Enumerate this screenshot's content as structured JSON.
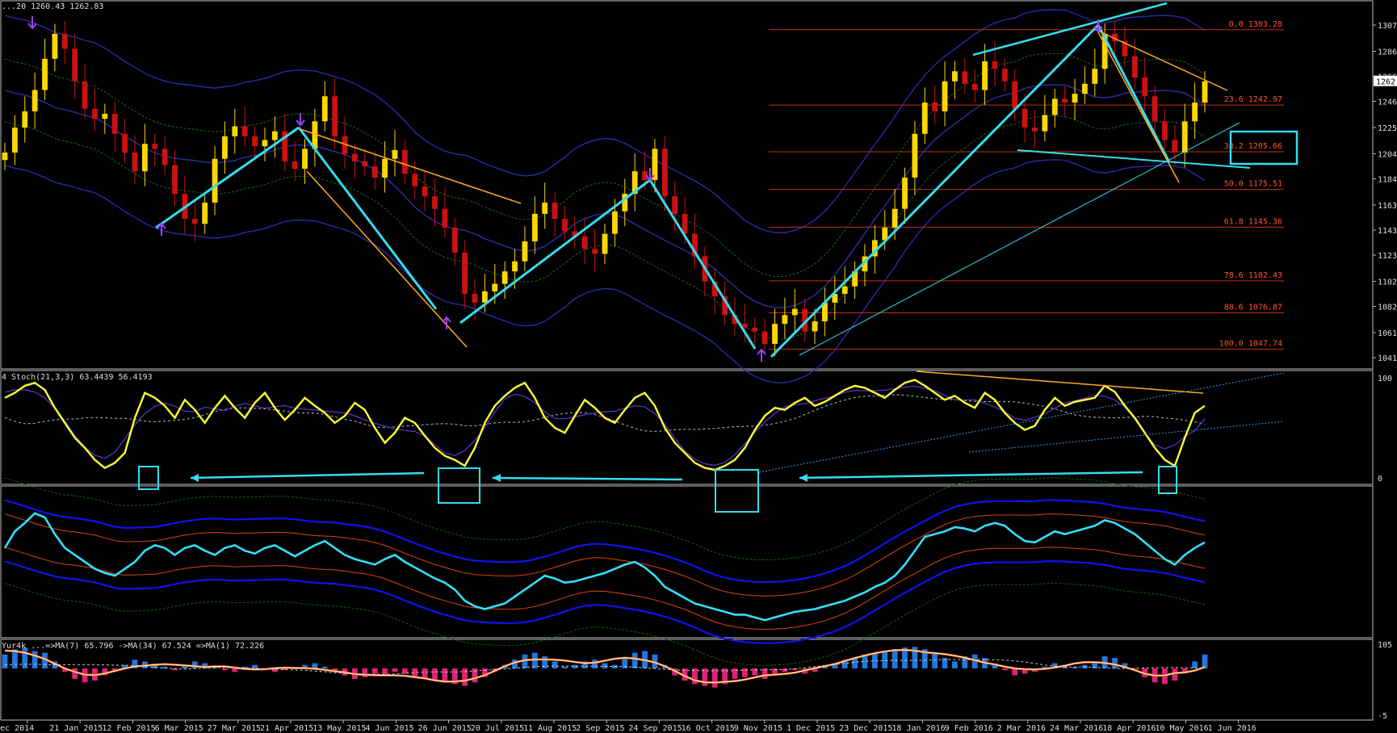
{
  "chart_data": [
    {
      "type": "candlestick",
      "pane": "price",
      "header": "...20 1260.43 1262.83",
      "y_ticks": [
        "1307",
        "1286",
        "1266",
        "1246",
        "1225",
        "1204",
        "1184",
        "1163",
        "1143",
        "1123",
        "1102",
        "1082",
        "1061",
        "1041"
      ],
      "ylim": [
        1041,
        1307
      ],
      "current_price": "1262",
      "x_ticks": [
        "ec 2014",
        "21 Jan 2015",
        "12 Feb 2015",
        "6 Mar 2015",
        "27 Mar 2015",
        "21 Apr 2015",
        "13 May 2015",
        "4 Jun 2015",
        "26 Jun 2015",
        "20 Jul 2015",
        "11 Aug 2015",
        "2 Sep 2015",
        "24 Sep 2015",
        "16 Oct 2015",
        "9 Nov 2015",
        "1 Dec 2015",
        "23 Dec 2015",
        "18 Jan 2016",
        "9 Feb 2016",
        "2 Mar 2016",
        "24 Mar 2016",
        "18 Apr 2016",
        "10 May 2016",
        "1 Jun 2016"
      ],
      "close_series": [
        1205,
        1225,
        1238,
        1255,
        1280,
        1300,
        1288,
        1262,
        1240,
        1232,
        1236,
        1220,
        1205,
        1190,
        1212,
        1208,
        1195,
        1172,
        1152,
        1148,
        1165,
        1200,
        1218,
        1226,
        1218,
        1210,
        1215,
        1222,
        1198,
        1192,
        1208,
        1230,
        1250,
        1218,
        1204,
        1198,
        1194,
        1185,
        1200,
        1207,
        1188,
        1178,
        1170,
        1160,
        1145,
        1125,
        1092,
        1085,
        1094,
        1100,
        1110,
        1118,
        1134,
        1156,
        1165,
        1152,
        1142,
        1138,
        1128,
        1124,
        1140,
        1158,
        1172,
        1190,
        1183,
        1208,
        1170,
        1156,
        1140,
        1122,
        1102,
        1090,
        1075,
        1068,
        1065,
        1062,
        1052,
        1068,
        1075,
        1080,
        1062,
        1070,
        1085,
        1092,
        1098,
        1110,
        1122,
        1135,
        1145,
        1160,
        1185,
        1220,
        1245,
        1238,
        1262,
        1270,
        1260,
        1255,
        1278,
        1272,
        1262,
        1240,
        1225,
        1222,
        1235,
        1248,
        1245,
        1252,
        1260,
        1272,
        1300,
        1294,
        1282,
        1265,
        1250,
        1230,
        1215,
        1205,
        1230,
        1245,
        1262
      ],
      "fib_levels": [
        {
          "ratio": "0.0",
          "price": "1303.28"
        },
        {
          "ratio": "23.6",
          "price": "1242.97"
        },
        {
          "ratio": "38.2",
          "price": "1205.66"
        },
        {
          "ratio": "50.0",
          "price": "1175.51"
        },
        {
          "ratio": "61.8",
          "price": "1145.36"
        },
        {
          "ratio": "78.6",
          "price": "1102.43"
        },
        {
          "ratio": "88.6",
          "price": "1076.87"
        },
        {
          "ratio": "100.0",
          "price": "1047.74"
        }
      ]
    },
    {
      "type": "line",
      "pane": "stochastic",
      "header": "4  Stoch(21,3,3) 63.4439 56.4193",
      "y_ticks": [
        "100",
        "0"
      ],
      "ylim": [
        0,
        100
      ],
      "k_series": [
        80,
        85,
        92,
        95,
        88,
        70,
        55,
        40,
        30,
        18,
        10,
        15,
        25,
        60,
        85,
        80,
        72,
        60,
        78,
        68,
        55,
        70,
        82,
        70,
        60,
        75,
        85,
        70,
        58,
        68,
        80,
        72,
        65,
        55,
        62,
        75,
        68,
        50,
        35,
        45,
        60,
        55,
        42,
        30,
        22,
        18,
        12,
        30,
        55,
        72,
        82,
        90,
        95,
        80,
        60,
        50,
        45,
        62,
        78,
        70,
        60,
        55,
        68,
        80,
        85,
        72,
        50,
        35,
        25,
        15,
        10,
        8,
        12,
        18,
        30,
        48,
        62,
        70,
        68,
        75,
        80,
        72,
        76,
        82,
        88,
        92,
        90,
        85,
        80,
        88,
        95,
        98,
        92,
        85,
        78,
        82,
        75,
        70,
        85,
        78,
        65,
        55,
        48,
        52,
        68,
        80,
        72,
        76,
        78,
        80,
        92,
        86,
        72,
        60,
        45,
        30,
        18,
        12,
        40,
        65,
        72
      ]
    },
    {
      "type": "line",
      "pane": "oscillator",
      "series": [
        {
          "values": [
            60,
            72,
            78,
            85,
            82,
            70,
            60,
            55,
            50,
            45,
            42,
            40,
            45,
            50,
            58,
            62,
            60,
            55,
            60,
            62,
            58,
            55,
            60,
            62,
            58,
            56,
            60,
            62,
            58,
            54,
            58,
            62,
            65,
            60,
            55,
            52,
            50,
            48,
            52,
            55,
            50,
            46,
            42,
            38,
            35,
            30,
            22,
            18,
            16,
            18,
            20,
            25,
            30,
            35,
            40,
            38,
            35,
            36,
            38,
            40,
            42,
            45,
            48,
            50,
            46,
            40,
            32,
            28,
            24,
            20,
            18,
            16,
            14,
            12,
            12,
            10,
            8,
            10,
            12,
            14,
            15,
            16,
            18,
            20,
            22,
            25,
            28,
            32,
            35,
            40,
            48,
            58,
            68,
            70,
            72,
            75,
            74,
            72,
            76,
            78,
            76,
            70,
            65,
            64,
            68,
            72,
            70,
            72,
            74,
            76,
            80,
            78,
            74,
            70,
            64,
            58,
            52,
            48,
            55,
            60,
            64
          ]
        }
      ]
    },
    {
      "type": "bar",
      "pane": "histogram",
      "header": "Yur4k  ...=>MA(7) 65.796  ->MA(34) 67.524  =>MA(1) 72.226",
      "y_ticks": [
        "105",
        "-5"
      ],
      "values": [
        40,
        55,
        60,
        50,
        45,
        20,
        -10,
        -30,
        -40,
        -35,
        -20,
        -10,
        10,
        25,
        20,
        10,
        5,
        -5,
        10,
        20,
        15,
        5,
        -5,
        -10,
        5,
        10,
        -5,
        -10,
        -5,
        0,
        10,
        15,
        5,
        -10,
        -20,
        -30,
        -25,
        -15,
        -20,
        -10,
        -15,
        -25,
        -30,
        -35,
        -40,
        -45,
        -50,
        -40,
        -25,
        -10,
        10,
        25,
        40,
        45,
        35,
        20,
        5,
        10,
        20,
        25,
        15,
        10,
        30,
        45,
        50,
        40,
        10,
        -20,
        -35,
        -45,
        -50,
        -55,
        -45,
        -30,
        -25,
        -20,
        -30,
        -20,
        -10,
        -5,
        -15,
        -10,
        5,
        15,
        25,
        30,
        40,
        45,
        50,
        55,
        60,
        62,
        55,
        45,
        30,
        20,
        35,
        40,
        30,
        15,
        -5,
        -20,
        -15,
        -10,
        5,
        15,
        10,
        5,
        10,
        20,
        35,
        30,
        15,
        -5,
        -25,
        -40,
        -45,
        -35,
        -10,
        20,
        40
      ]
    }
  ]
}
